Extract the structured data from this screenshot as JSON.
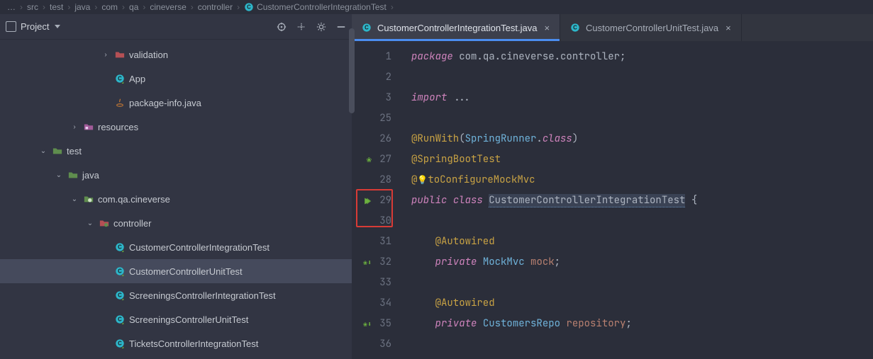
{
  "breadcrumb": [
    "src",
    "test",
    "java",
    "com",
    "qa",
    "cineverse",
    "controller",
    "CustomerControllerIntegrationTest"
  ],
  "sidebar": {
    "title": "Project",
    "items": [
      {
        "depth": 6,
        "arrow": "right",
        "icon": "folder-red",
        "label": "validation"
      },
      {
        "depth": 6,
        "arrow": "",
        "icon": "class",
        "label": "App"
      },
      {
        "depth": 6,
        "arrow": "",
        "icon": "java",
        "label": "package-info.java"
      },
      {
        "depth": 4,
        "arrow": "right",
        "icon": "folder-res",
        "label": "resources"
      },
      {
        "depth": 2,
        "arrow": "down",
        "icon": "folder-test",
        "label": "test"
      },
      {
        "depth": 3,
        "arrow": "down",
        "icon": "folder-test",
        "label": "java"
      },
      {
        "depth": 4,
        "arrow": "down",
        "icon": "folder-pkg",
        "label": "com.qa.cineverse"
      },
      {
        "depth": 5,
        "arrow": "down",
        "icon": "folder-ctl",
        "label": "controller"
      },
      {
        "depth": 6,
        "arrow": "",
        "icon": "class",
        "label": "CustomerControllerIntegrationTest"
      },
      {
        "depth": 6,
        "arrow": "",
        "icon": "class",
        "label": "CustomerControllerUnitTest",
        "selected": true
      },
      {
        "depth": 6,
        "arrow": "",
        "icon": "class",
        "label": "ScreeningsControllerIntegrationTest"
      },
      {
        "depth": 6,
        "arrow": "",
        "icon": "class",
        "label": "ScreeningsControllerUnitTest"
      },
      {
        "depth": 6,
        "arrow": "",
        "icon": "class",
        "label": "TicketsControllerIntegrationTest"
      }
    ]
  },
  "tabs": [
    {
      "label": "CustomerControllerIntegrationTest.java",
      "active": true
    },
    {
      "label": "CustomerControllerUnitTest.java",
      "active": false
    }
  ],
  "gutter": {
    "lines": [
      1,
      2,
      3,
      25,
      26,
      27,
      28,
      29,
      30,
      31,
      32,
      33,
      34,
      35,
      36
    ],
    "springLeaf": [
      27
    ],
    "download": [
      32,
      35
    ],
    "runArrow": 29,
    "redBoxStartLine": 29
  },
  "code": {
    "package_kw": "package",
    "package_name": "com.qa.cineverse.controller",
    "import_kw": "import",
    "import_rest": " ...",
    "ann_runwith": "@RunWith",
    "ann_runwith_arg_type": "SpringRunner",
    "ann_runwith_arg_kw": "class",
    "ann_springboot": "@SpringBootTest",
    "ann_automock": "toConfigureMockMvc",
    "public_kw": "public",
    "class_kw": "class",
    "class_name": "CustomerControllerIntegrationTest",
    "open_brace": " {",
    "ann_autowired": "@Autowired",
    "private_kw": "private",
    "type_mockmvc": "MockMvc",
    "field_mock": "mock",
    "type_repo": "CustomersRepo",
    "field_repo": "repository"
  }
}
